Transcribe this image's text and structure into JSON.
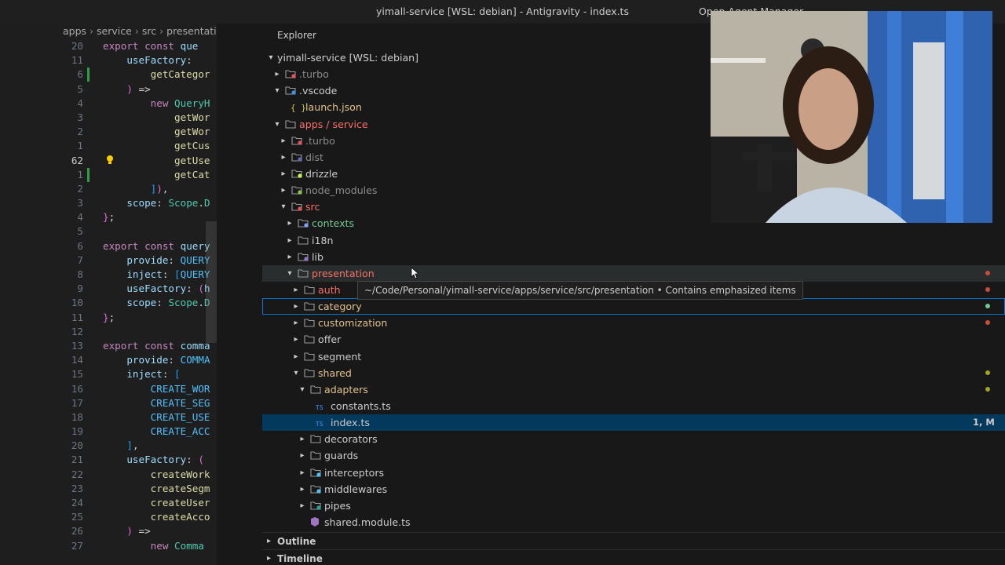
{
  "window": {
    "title": "yimall-service [WSL: debian] - Antigravity - index.ts",
    "right_text": "Open Agent Manager"
  },
  "editor": {
    "breadcrumb": [
      "apps",
      "service",
      "src",
      "presentation"
    ],
    "sticky_lines": [
      {
        "number": "20",
        "text": "export const que"
      },
      {
        "number": "11",
        "text": "    useFactory:"
      }
    ],
    "lines": [
      {
        "number": "6",
        "text": "        getCategor"
      },
      {
        "number": "5",
        "text": "    ) =>"
      },
      {
        "number": "4",
        "text": "        new QueryH"
      },
      {
        "number": "3",
        "text": "            getWor"
      },
      {
        "number": "2",
        "text": "            getWor"
      },
      {
        "number": "1",
        "text": "            getCus"
      },
      {
        "number": "62",
        "text": "            getUse"
      },
      {
        "number": "1",
        "text": "            getCat"
      },
      {
        "number": "2",
        "text": "        ]),"
      },
      {
        "number": "3",
        "text": "    scope: Scope.D"
      },
      {
        "number": "4",
        "text": "};"
      },
      {
        "number": "5",
        "text": ""
      },
      {
        "number": "6",
        "text": "export const query"
      },
      {
        "number": "7",
        "text": "    provide: QUERY"
      },
      {
        "number": "8",
        "text": "    inject: [QUERY"
      },
      {
        "number": "9",
        "text": "    useFactory: (h"
      },
      {
        "number": "10",
        "text": "    scope: Scope.D"
      },
      {
        "number": "11",
        "text": "};"
      },
      {
        "number": "12",
        "text": ""
      },
      {
        "number": "13",
        "text": "export const comma"
      },
      {
        "number": "14",
        "text": "    provide: COMMA"
      },
      {
        "number": "15",
        "text": "    inject: ["
      },
      {
        "number": "16",
        "text": "        CREATE_WOR"
      },
      {
        "number": "17",
        "text": "        CREATE_SEG"
      },
      {
        "number": "18",
        "text": "        CREATE_USE"
      },
      {
        "number": "19",
        "text": "        CREATE_ACC"
      },
      {
        "number": "20",
        "text": "    ],"
      },
      {
        "number": "21",
        "text": "    useFactory: ("
      },
      {
        "number": "22",
        "text": "        createWork"
      },
      {
        "number": "23",
        "text": "        createSegm"
      },
      {
        "number": "24",
        "text": "        createUser"
      },
      {
        "number": "25",
        "text": "        createAcco"
      },
      {
        "number": "26",
        "text": "    ) =>"
      },
      {
        "number": "27",
        "text": "        new Comma"
      }
    ],
    "current_line": "62"
  },
  "explorer": {
    "title": "Explorer",
    "root": "yimall-service [WSL: debian]",
    "tree": [
      {
        "label": ".turbo",
        "depth": 1,
        "kind": "folder",
        "open": false,
        "color": "dim",
        "icon": "turbo-folder-icon"
      },
      {
        "label": ".vscode",
        "depth": 1,
        "kind": "folder",
        "open": true,
        "color": "norm",
        "icon": "vscode-folder-icon"
      },
      {
        "label": "launch.json",
        "depth": 2,
        "kind": "file",
        "color": "mod",
        "icon": "json-icon"
      },
      {
        "label": "apps / service",
        "depth": 1,
        "kind": "folder",
        "open": true,
        "color": "red",
        "icon": "folder-icon"
      },
      {
        "label": ".turbo",
        "depth": 2,
        "kind": "folder",
        "open": false,
        "color": "dim",
        "icon": "turbo-folder-icon"
      },
      {
        "label": "dist",
        "depth": 2,
        "kind": "folder",
        "open": false,
        "color": "dim",
        "icon": "dist-folder-icon"
      },
      {
        "label": "drizzle",
        "depth": 2,
        "kind": "folder",
        "open": false,
        "color": "norm",
        "icon": "drizzle-folder-icon"
      },
      {
        "label": "node_modules",
        "depth": 2,
        "kind": "folder",
        "open": false,
        "color": "dim",
        "icon": "node-modules-folder-icon"
      },
      {
        "label": "src",
        "depth": 2,
        "kind": "folder",
        "open": true,
        "color": "red",
        "icon": "src-folder-icon"
      },
      {
        "label": "contexts",
        "depth": 3,
        "kind": "folder",
        "open": false,
        "color": "new",
        "icon": "contexts-folder-icon"
      },
      {
        "label": "i18n",
        "depth": 3,
        "kind": "folder",
        "open": false,
        "color": "norm",
        "icon": "i18n-folder-icon"
      },
      {
        "label": "lib",
        "depth": 3,
        "kind": "folder",
        "open": false,
        "color": "norm",
        "icon": "lib-folder-icon"
      },
      {
        "label": "presentation",
        "depth": 3,
        "kind": "folder",
        "open": true,
        "color": "red",
        "icon": "folder-icon",
        "state": "hover",
        "dot": "#c74e39"
      },
      {
        "label": "auth",
        "depth": 4,
        "kind": "folder",
        "open": false,
        "color": "red",
        "icon": "folder-icon",
        "dot": "#c74e39"
      },
      {
        "label": "category",
        "depth": 4,
        "kind": "folder",
        "open": false,
        "color": "mod",
        "icon": "folder-icon",
        "state": "focus",
        "dot": "#73c991"
      },
      {
        "label": "customization",
        "depth": 4,
        "kind": "folder",
        "open": false,
        "color": "mod",
        "icon": "folder-icon",
        "dot": "#c74e39"
      },
      {
        "label": "offer",
        "depth": 4,
        "kind": "folder",
        "open": false,
        "color": "norm",
        "icon": "folder-icon"
      },
      {
        "label": "segment",
        "depth": 4,
        "kind": "folder",
        "open": false,
        "color": "norm",
        "icon": "folder-icon"
      },
      {
        "label": "shared",
        "depth": 4,
        "kind": "folder",
        "open": true,
        "color": "mod",
        "icon": "folder-icon",
        "dot": "#a3a31f"
      },
      {
        "label": "adapters",
        "depth": 5,
        "kind": "folder",
        "open": true,
        "color": "mod",
        "icon": "folder-icon",
        "dot": "#a3a31f"
      },
      {
        "label": "constants.ts",
        "depth": 6,
        "kind": "file",
        "color": "norm",
        "icon": "typescript-icon"
      },
      {
        "label": "index.ts",
        "depth": 6,
        "kind": "file",
        "color": "norm",
        "icon": "typescript-icon",
        "state": "selected",
        "badge": "1, M"
      },
      {
        "label": "decorators",
        "depth": 5,
        "kind": "folder",
        "open": false,
        "color": "norm",
        "icon": "folder-icon"
      },
      {
        "label": "guards",
        "depth": 5,
        "kind": "folder",
        "open": false,
        "color": "norm",
        "icon": "folder-icon"
      },
      {
        "label": "interceptors",
        "depth": 5,
        "kind": "folder",
        "open": false,
        "color": "norm",
        "icon": "interceptors-folder-icon"
      },
      {
        "label": "middlewares",
        "depth": 5,
        "kind": "folder",
        "open": false,
        "color": "norm",
        "icon": "middlewares-folder-icon"
      },
      {
        "label": "pipes",
        "depth": 5,
        "kind": "folder",
        "open": false,
        "color": "norm",
        "icon": "pipes-folder-icon"
      },
      {
        "label": "shared.module.ts",
        "depth": 5,
        "kind": "file",
        "color": "norm",
        "icon": "nestjs-module-icon"
      }
    ],
    "tooltip": "~/Code/Personal/yimall-service/apps/service/src/presentation • Contains emphasized items",
    "sections": [
      "Outline",
      "Timeline"
    ]
  },
  "colors": {
    "red": "#f47067",
    "mod": "#e2c08d",
    "new": "#73c991",
    "selection": "#04395e",
    "focus_border": "#0078d4"
  }
}
